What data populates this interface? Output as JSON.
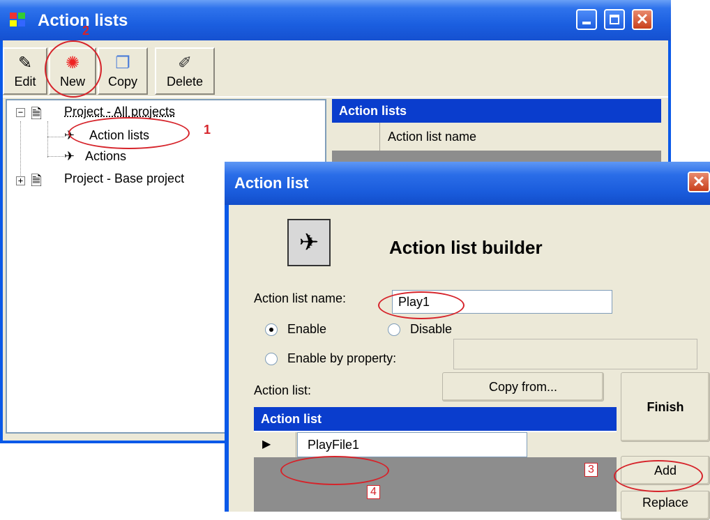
{
  "main_window": {
    "title": "Action lists",
    "toolbar": [
      {
        "label": "Edit",
        "icon": "edit-icon"
      },
      {
        "label": "New",
        "icon": "new-icon"
      },
      {
        "label": "Copy",
        "icon": "copy-icon"
      },
      {
        "label": "Delete",
        "icon": "delete-icon"
      }
    ],
    "tree": [
      {
        "label": "Project - All projects",
        "expander": "−"
      },
      {
        "label": "Action lists"
      },
      {
        "label": "Actions"
      },
      {
        "label": "Project - Base project",
        "expander": "+"
      }
    ],
    "grid": {
      "header": "Action lists",
      "column": "Action list name"
    }
  },
  "dialog": {
    "title": "Action list",
    "heading": "Action list builder",
    "name_label": "Action list name:",
    "name_value": "Play1",
    "radio_enable": "Enable",
    "radio_disable": "Disable",
    "radio_by_property": "Enable by property:",
    "action_list_label": "Action list:",
    "copy_from_button": "Copy from...",
    "finish_button": "Finish",
    "add_button": "Add",
    "replace_button": "Replace",
    "grid_header": "Action list",
    "grid_row_value": "PlayFile1"
  },
  "annotations": {
    "n1": "1",
    "n2": "2",
    "n3": "3",
    "n4": "4"
  },
  "colors": {
    "title_blue": "#1b5fe0",
    "annotation_red": "#d6232a",
    "dialog_close_red": "#c8401c"
  }
}
